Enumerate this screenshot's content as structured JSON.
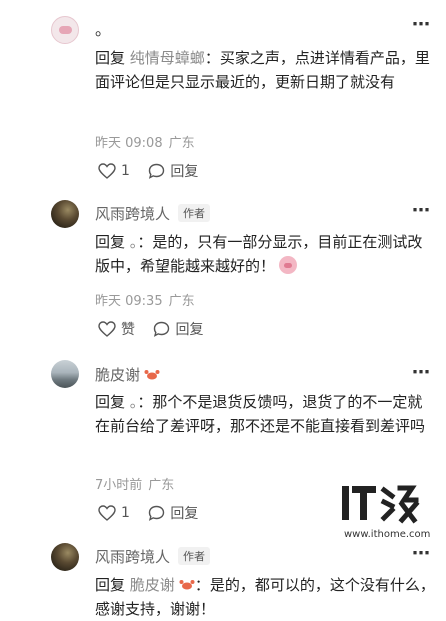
{
  "comments": [
    {
      "name": "。",
      "reply_prefix": "回复",
      "reply_target": "纯情母蟑螂",
      "text": "：买家之声，点进详情看产品，里面评论但是只显示最近的，更新日期了就没有",
      "time": "昨天 09:08",
      "location": "广东",
      "like": "1",
      "reply": "回复"
    },
    {
      "name": "风雨跨境人",
      "badge": "作者",
      "reply_prefix": "回复",
      "reply_target": "。",
      "text": "：是的，只有一部分显示，目前正在测试改版中，希望能越来越好的！",
      "time": "昨天 09:35",
      "location": "广东",
      "like": "赞",
      "reply": "回复"
    },
    {
      "name": "脆皮谢",
      "reply_prefix": "回复",
      "reply_target": "。",
      "text": "：那个不是退货反馈吗，退货了的不一定就在前台给了差评呀，那不还是不能直接看到差评吗",
      "time": "7小时前",
      "location": "广东",
      "like": "1",
      "reply": "回复"
    },
    {
      "name": "风雨跨境人",
      "badge": "作者",
      "reply_prefix": "回复",
      "reply_target": "脆皮谢",
      "text": "：是的，都可以的，这个没有什么，感谢支持，谢谢！"
    }
  ],
  "more_icon": "more-dots-icon",
  "watermark": {
    "logo": "IT之家",
    "url": "www.ithome.com"
  }
}
